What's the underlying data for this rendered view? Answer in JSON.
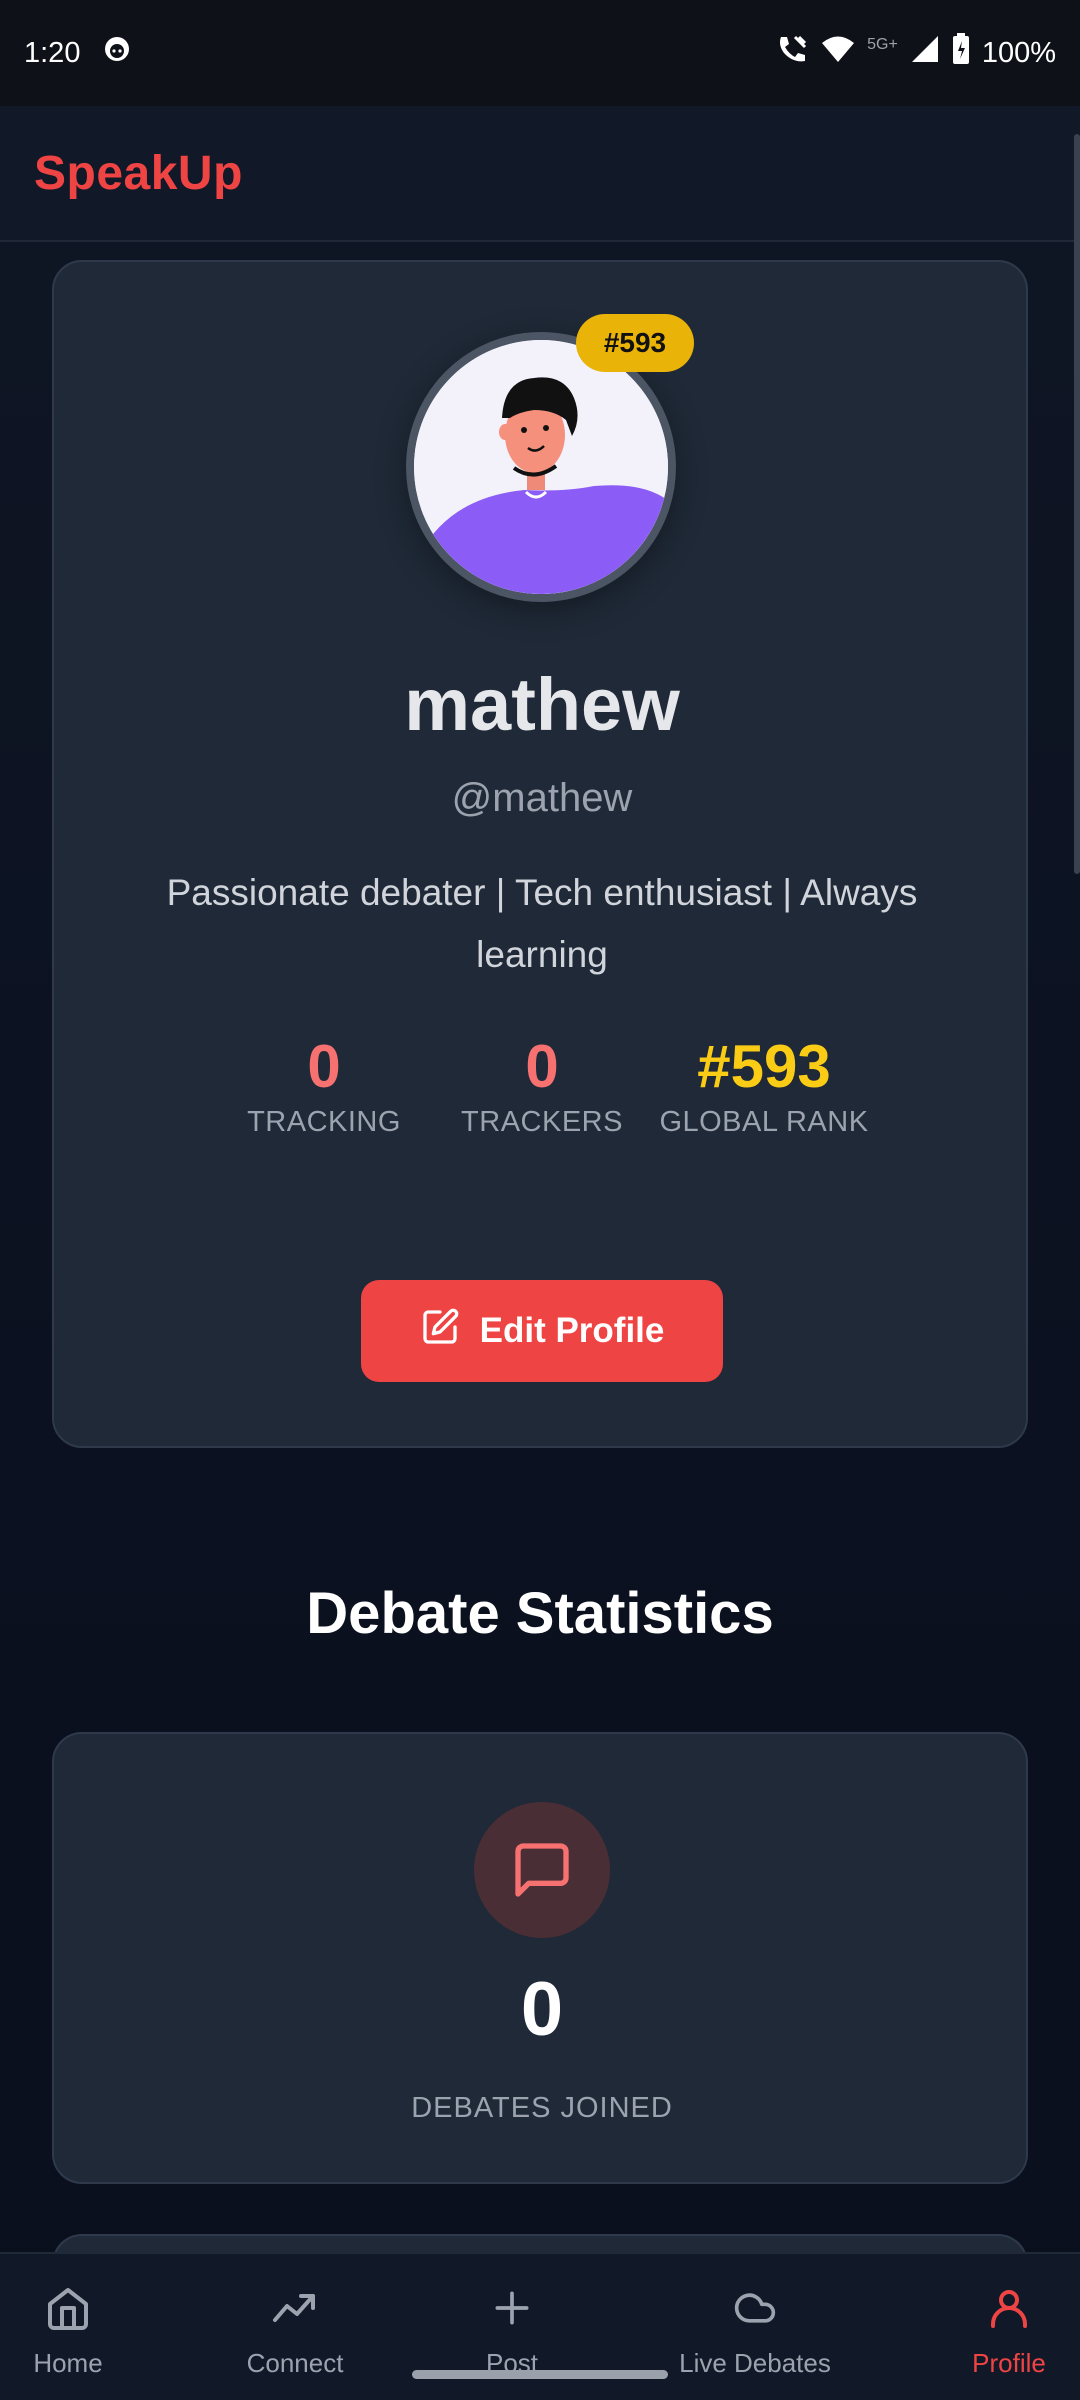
{
  "status_bar": {
    "time": "1:20",
    "network": "5G+",
    "battery": "100%",
    "icons": [
      "notification-face-icon",
      "wifi-calling-icon",
      "wifi-icon",
      "signal-icon",
      "battery-icon"
    ]
  },
  "app": {
    "title": "SpeakUp",
    "accent_color": "#ef4444"
  },
  "profile": {
    "rank_badge": "#593",
    "name": "mathew",
    "handle": "@mathew",
    "bio": "Passionate debater | Tech enthusiast | Always learning",
    "stats": [
      {
        "value": "0",
        "label": "TRACKING"
      },
      {
        "value": "0",
        "label": "TRACKERS"
      },
      {
        "value": "#593",
        "label": "GLOBAL RANK"
      }
    ],
    "edit_button": "Edit Profile"
  },
  "debate_statistics": {
    "title": "Debate Statistics",
    "cards": [
      {
        "value": "0",
        "label": "DEBATES JOINED",
        "icon": "message-square-icon"
      }
    ]
  },
  "bottom_nav": {
    "items": [
      {
        "label": "Home",
        "icon": "home-icon"
      },
      {
        "label": "Connect",
        "icon": "trending-icon"
      },
      {
        "label": "Post",
        "icon": "plus-icon"
      },
      {
        "label": "Live Debates",
        "icon": "cloud-icon"
      },
      {
        "label": "Profile",
        "icon": "user-icon",
        "active": true
      }
    ]
  }
}
